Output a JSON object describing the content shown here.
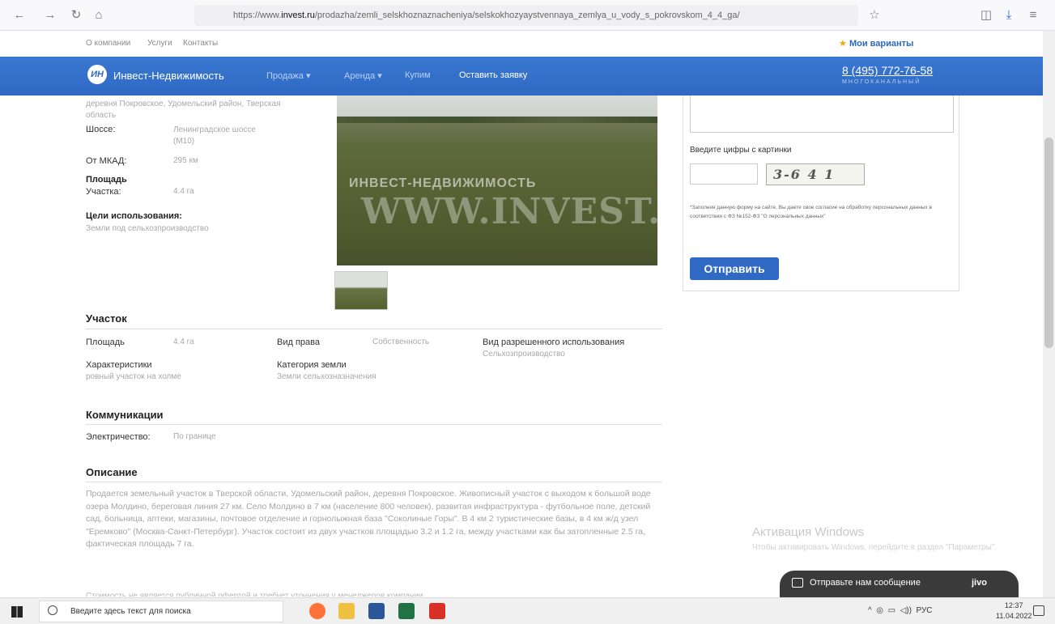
{
  "browser": {
    "url_prefix": "https://www.",
    "url_domain": "invest.ru",
    "url_rest": "/prodazha/zemli_selskhoznaznacheniya/selskokhozyaystvennaya_zemlya_u_vody_s_pokrovskom_4_4_ga/"
  },
  "site": {
    "top_links": [
      "О компании",
      "Услуги",
      "Контакты"
    ],
    "my_variants": "Мои варианты",
    "logo_mark": "ИН",
    "logo_text": "Инвест-Недвижимость",
    "nav": [
      "Продажа ▾",
      "Аренда ▾",
      "Купим"
    ],
    "nav_request": "Оставить заявку",
    "phone": "8 (495) 772-76-58",
    "phone_sub": "МНОГОКАНАЛЬНЫЙ"
  },
  "info": {
    "address": "деревня Покровское, Удомельский район, Тверская область",
    "highway_label": "Шоссе:",
    "highway_value": "Ленинградское шоссе (М10)",
    "mkad_label": "От МКАД:",
    "mkad_value": "295 км",
    "area_heading": "Площадь",
    "plot_label": "Участка:",
    "plot_value": "4.4 га",
    "purpose_heading": "Цели использования:",
    "purpose_value": "Земли под сельхозпроизводство"
  },
  "photo": {
    "watermark1": "ИНВЕСТ-НЕДВИЖИМОСТЬ",
    "watermark2": "WWW.INVEST.RU"
  },
  "form": {
    "captcha_label": "Введите цифры с картинки",
    "captcha_text": "3-6 4 1",
    "consent": "*Заполняя данную форму на сайте, Вы даете свое согласие на обработку персональных данных в соответствии с ФЗ №152-ФЗ \"О персональных данных\"",
    "submit": "Отправить"
  },
  "plot": {
    "heading": "Участок",
    "area_label": "Площадь",
    "area_value": "4.4 га",
    "right_label": "Вид права",
    "right_value": "Собственность",
    "use_label": "Вид разрешенного использования",
    "use_value": "Сельхозпроизводство",
    "char_label": "Характеристики",
    "char_value": "ровный участок на холме",
    "cat_label": "Категория земли",
    "cat_value": "Земли сельхозназначения"
  },
  "comms": {
    "heading": "Коммуникации",
    "elec_label": "Электричество:",
    "elec_value": "По границе"
  },
  "description": {
    "heading": "Описание",
    "text": "Продается земельный участок в Тверской области, Удомельский район, деревня Покровское. Живописный участок с выходом к большой воде озера Молдино, береговая линия 27 км. Село Молдино в 7 км (население 800 человек), развитая инфраструктура - футбольное поле, детский сад, больница, аптеки, магазины, почтовое отделение и горнолыжная база \"Соколиные Горы\". В 4 км 2 туристические базы, в 4 км ж/д узел \"Еремково\" (Москва-Санкт-Петербург). Участок состоит из двух участков площадью 3.2 и 1.2 га, между участками как бы затопленные 2.5 га, фактическая площадь 7 га.",
    "cut_line": "Стоимость не является публичной офертой и требует уточнения у менеджеров компании"
  },
  "windows": {
    "activation_title": "Активация Windows",
    "activation_text": "Чтобы активировать Windows, перейдите в раздел \"Параметры\"."
  },
  "chat": {
    "text": "Отправьте нам сообщение",
    "brand": "jivo"
  },
  "taskbar": {
    "search_placeholder": "Введите здесь текст для поиска",
    "lang": "РУС",
    "time": "12:37",
    "date": "11.04.2022"
  }
}
